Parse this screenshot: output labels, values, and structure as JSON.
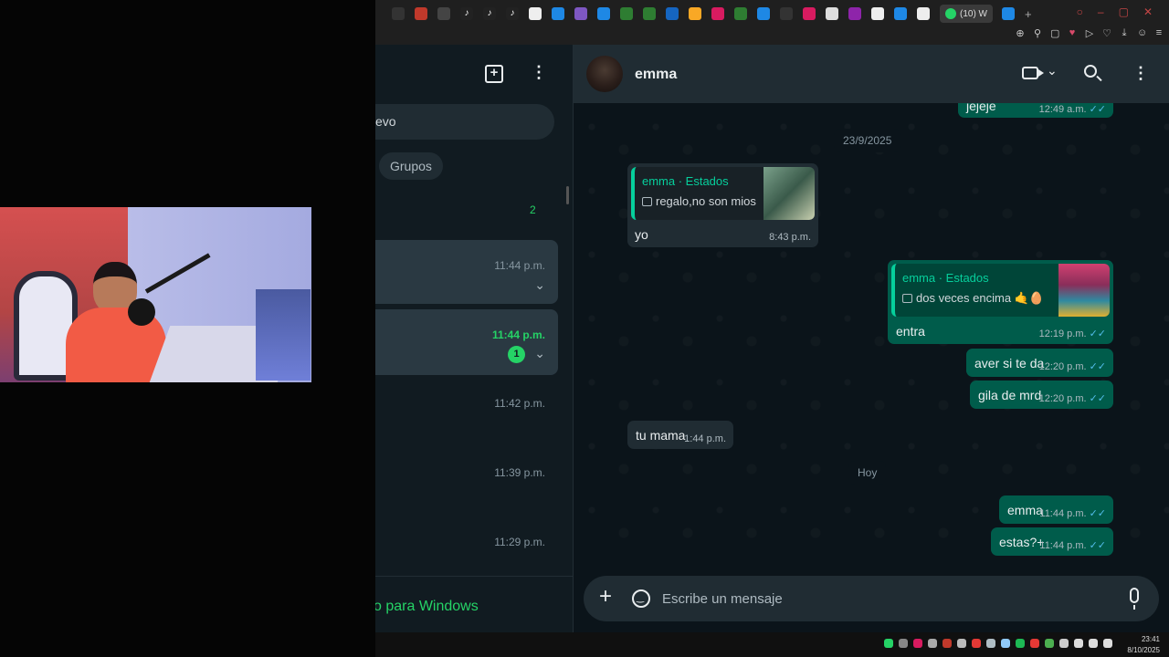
{
  "chrome": {
    "active_tab_label": "(10) W",
    "new_tab": "+"
  },
  "chatlist": {
    "search_text": "evo",
    "filter_chip": "Grupos",
    "archived_count": "2",
    "rows": [
      {
        "time": "11:44 p.m."
      },
      {
        "time": "11:44 p.m.",
        "badge": "1"
      },
      {
        "time": "11:42 p.m."
      },
      {
        "time": "11:39 p.m."
      },
      {
        "time": "11:29 p.m."
      }
    ],
    "footer_link": "o para Windows"
  },
  "conversation": {
    "contact_name": "emma",
    "messages": {
      "m0": {
        "text": "jejeje",
        "time": "12:49 a.m."
      },
      "date1": "23/9/2025",
      "m1": {
        "quote_name": "emma · Estados",
        "quote_text": "regalo,no son mios",
        "text": "yo",
        "time": "8:43 p.m."
      },
      "m2": {
        "quote_name": "emma · Estados",
        "quote_text": "dos veces encima 🤙🥚",
        "text": "entra",
        "time": "12:19 p.m."
      },
      "m3": {
        "text": "aver si te da",
        "time": "12:20 p.m."
      },
      "m4": {
        "text": "gila de mrd",
        "time": "12:20 p.m."
      },
      "m5": {
        "text": "tu mama",
        "time": "1:44 p.m."
      },
      "date2": "Hoy",
      "m6": {
        "text": "emma",
        "time": "11:44 p.m."
      },
      "m7": {
        "text": "estas?+",
        "time": "11:44 p.m."
      }
    },
    "composer_placeholder": "Escribe un mensaje"
  },
  "taskbar": {
    "time": "23:41",
    "date": "8/10/2025"
  },
  "colors": {
    "accent": "#25d366",
    "outgoing_bubble": "#005c4b",
    "incoming_bubble": "#202c33",
    "panel": "#111b21",
    "read_ticks": "#53bdeb"
  }
}
